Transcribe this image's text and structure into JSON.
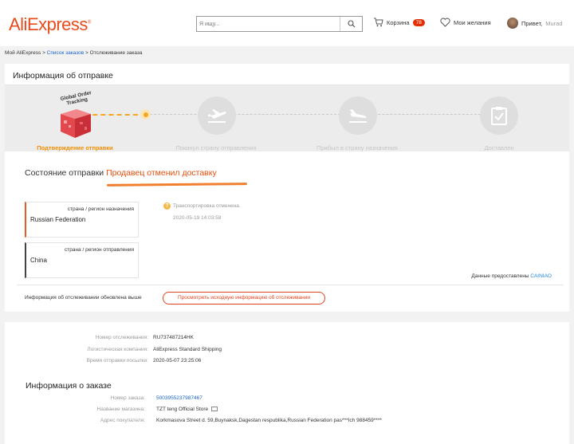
{
  "header": {
    "logo": "AliExpress",
    "search_placeholder": "Я ищу...",
    "cart_label": "Корзина",
    "cart_count": "78",
    "wishlist_label": "Мои желания",
    "greeting": "Привет,",
    "username": "Murad"
  },
  "breadcrumb": {
    "home": "Мой AliExpress",
    "sep1": ">",
    "orders": "Список заказов",
    "sep2": ">",
    "current": "Отслеживание заказа"
  },
  "shipping": {
    "title": "Информация об отправке",
    "badge": "Global Order Tracking",
    "steps": [
      {
        "label": "Подтверждение отправки",
        "active": true,
        "icon": "box-icon"
      },
      {
        "label": "Покинул страну отправления",
        "active": false,
        "icon": "plane-departure-icon"
      },
      {
        "label": "Прибыл в страну назначения",
        "active": false,
        "icon": "plane-arrival-icon"
      },
      {
        "label": "Доставлен",
        "active": false,
        "icon": "clipboard-check-icon"
      }
    ],
    "status_label": "Состояние отправки",
    "status_value": "Продавец отменил доставку",
    "destination": {
      "label": "страна / регион назначения",
      "value": "Russian Federation"
    },
    "origin": {
      "label": "страна / регион отправления",
      "value": "China"
    },
    "event": {
      "text": "Транспортировка отменена.",
      "time": "2020-05-19 14:03:58"
    },
    "provided_by_label": "Данные предоставлены",
    "provided_by": "CAINIAO",
    "update_note": "Информация об отслеживании обновлена выше",
    "source_button": "Просмотреть исходную информацию об отслеживании"
  },
  "logistics": {
    "tracking_number_label": "Номер отслеживания:",
    "tracking_number": "RU737487214HK",
    "company_label": "Логистическая компания:",
    "company": "AliExpress Standard Shipping",
    "sent_time_label": "Время отправки посылки:",
    "sent_time": "2020-05-07 23:25:06"
  },
  "order": {
    "title": "Информация о заказе",
    "number_label": "Номер заказа:",
    "number": "5003955237987467",
    "store_label": "Название магазина:",
    "store": "TZT teng Official Store",
    "address_label": "Адрес покупателя:",
    "address": "Korkmasova Street d. 59,Buynaksk,Dagestan respublika,Russian Federation pas***Ich 988459****"
  },
  "colors": {
    "brand": "#e74c1c",
    "active_step": "#f08e00",
    "status": "#e64e0d",
    "link": "#1a64c8"
  }
}
